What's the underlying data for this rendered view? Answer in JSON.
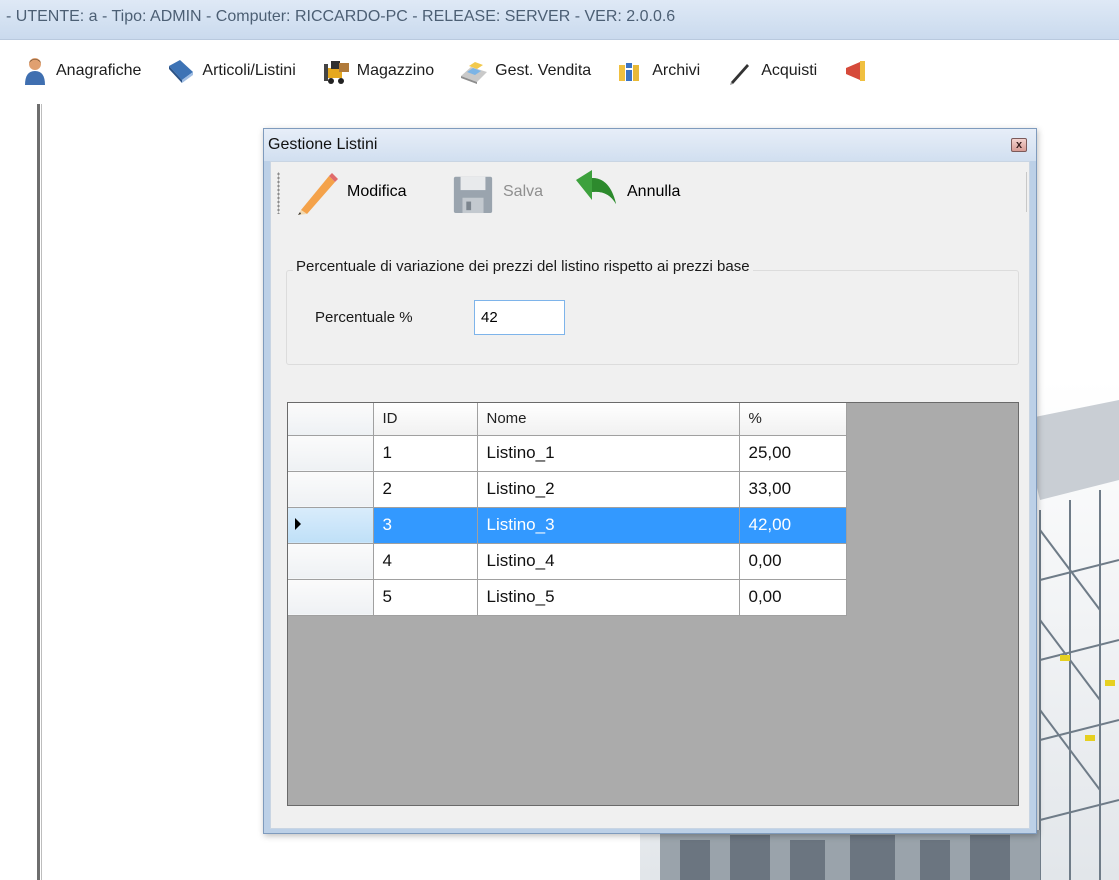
{
  "app": {
    "title": "- UTENTE: a - Tipo: ADMIN - Computer: RICCARDO-PC - RELEASE: SERVER - VER: 2.0.0.6"
  },
  "menu": {
    "items": [
      {
        "label": "Anagrafiche",
        "icon": "person-icon"
      },
      {
        "label": "Articoli/Listini",
        "icon": "book-icon"
      },
      {
        "label": "Magazzino",
        "icon": "forklift-icon"
      },
      {
        "label": "Gest. Vendita",
        "icon": "cash-register-icon"
      },
      {
        "label": "Archivi",
        "icon": "binders-icon"
      },
      {
        "label": "Acquisti",
        "icon": "pen-icon"
      }
    ]
  },
  "dialog": {
    "title": "Gestione Listini",
    "close_glyph": "x",
    "toolbar": {
      "modifica": "Modifica",
      "salva": "Salva",
      "annulla": "Annulla"
    },
    "group": {
      "legend": "Percentuale di variazione dei prezzi del listino rispetto ai prezzi base",
      "percent_label": "Percentuale %",
      "percent_value": "42"
    },
    "grid": {
      "columns": [
        "ID",
        "Nome",
        "%"
      ],
      "rows": [
        {
          "id": "1",
          "nome": "Listino_1",
          "pct": "25,00"
        },
        {
          "id": "2",
          "nome": "Listino_2",
          "pct": "33,00"
        },
        {
          "id": "3",
          "nome": "Listino_3",
          "pct": "42,00"
        },
        {
          "id": "4",
          "nome": "Listino_4",
          "pct": "0,00"
        },
        {
          "id": "5",
          "nome": "Listino_5",
          "pct": "0,00"
        }
      ],
      "selected_row_index": 2
    }
  },
  "colors": {
    "selection": "#3399ff",
    "grid_background": "#ababab",
    "titlebar": "#d2e0f1"
  }
}
